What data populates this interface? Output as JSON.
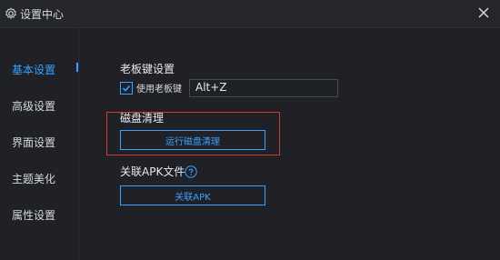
{
  "window": {
    "title": "设置中心",
    "icons": {
      "settings": "gear-icon",
      "close": "close-icon"
    }
  },
  "sidebar": {
    "items": [
      {
        "label": "基本设置",
        "active": true
      },
      {
        "label": "高级设置",
        "active": false
      },
      {
        "label": "界面设置",
        "active": false
      },
      {
        "label": "主题美化",
        "active": false
      },
      {
        "label": "属性设置",
        "active": false
      }
    ]
  },
  "boss_key": {
    "title": "老板键设置",
    "checkbox_label": "使用老板键",
    "checked": true,
    "hotkey_value": "Alt+Z"
  },
  "disk_cleanup": {
    "title": "磁盘清理",
    "button_label": "运行磁盘清理"
  },
  "apk_association": {
    "title": "关联APK文件",
    "help_icon": "question-circle-icon",
    "button_label": "关联APK"
  },
  "colors": {
    "accent": "#3aa0ff",
    "highlight_border": "#d23a32",
    "background": "#1f2127"
  }
}
